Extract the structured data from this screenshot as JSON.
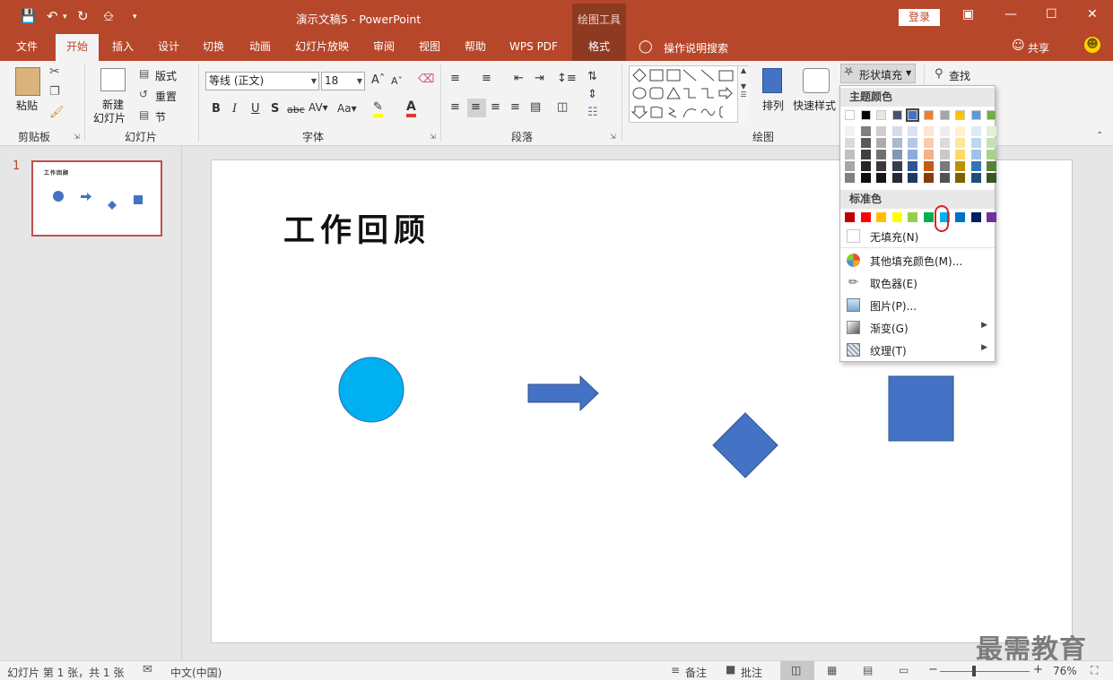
{
  "app": {
    "doc_title": "演示文稿5 - PowerPoint",
    "contextual_group": "绘图工具",
    "login": "登录"
  },
  "tabs": [
    "文件",
    "开始",
    "插入",
    "设计",
    "切换",
    "动画",
    "幻灯片放映",
    "审阅",
    "视图",
    "帮助",
    "WPS PDF",
    "格式"
  ],
  "tell_me": "操作说明搜索",
  "share": "共享",
  "ribbon": {
    "groups": {
      "clipboard": "剪贴板",
      "slides": "幻灯片",
      "font": "字体",
      "paragraph": "段落",
      "drawing": "绘图"
    },
    "paste": "粘贴",
    "new_slide_line1": "新建",
    "new_slide_line2": "幻灯片",
    "layout": "版式",
    "reset": "重置",
    "section": "节",
    "font_name": "等线 (正文)",
    "font_size": "18",
    "arrange": "排列",
    "quick_styles": "快速样式",
    "shape_fill": "形状填充",
    "find": "查找"
  },
  "fill_menu": {
    "theme_colors_title": "主题颜色",
    "standard_colors_title": "标准色",
    "theme_colors": [
      "#ffffff",
      "#000000",
      "#e7e6e6",
      "#44546a",
      "#4472c4",
      "#ed7d31",
      "#a5a5a5",
      "#ffc000",
      "#5b9bd5",
      "#70ad47"
    ],
    "theme_shades": [
      [
        "#f2f2f2",
        "#d9d9d9",
        "#bfbfbf",
        "#a6a6a6",
        "#808080"
      ],
      [
        "#7f7f7f",
        "#595959",
        "#404040",
        "#262626",
        "#0d0d0d"
      ],
      [
        "#d0cece",
        "#aeabab",
        "#757070",
        "#3a3838",
        "#171616"
      ],
      [
        "#d6dce5",
        "#adb9ca",
        "#8497b0",
        "#333f50",
        "#222a35"
      ],
      [
        "#dae3f3",
        "#b4c7e7",
        "#8faadc",
        "#2f5597",
        "#203864"
      ],
      [
        "#fbe5d6",
        "#f8cbad",
        "#f4b183",
        "#c55a11",
        "#843c0c"
      ],
      [
        "#ededed",
        "#dbdbdb",
        "#c9c9c9",
        "#7b7b7b",
        "#525252"
      ],
      [
        "#fff2cc",
        "#ffe699",
        "#ffd966",
        "#bf9000",
        "#7f6000"
      ],
      [
        "#deebf7",
        "#bdd7ee",
        "#9dc3e6",
        "#2e75b6",
        "#1f4e79"
      ],
      [
        "#e2f0d9",
        "#c5e0b4",
        "#a9d18e",
        "#548235",
        "#385723"
      ]
    ],
    "standard_colors": [
      "#c00000",
      "#ff0000",
      "#ffc000",
      "#ffff00",
      "#92d050",
      "#00b050",
      "#00b0f0",
      "#0070c0",
      "#002060",
      "#7030a0"
    ],
    "no_fill": "无填充(N)",
    "more_colors": "其他填充颜色(M)...",
    "eyedropper": "取色器(E)",
    "picture": "图片(P)...",
    "gradient": "渐变(G)",
    "texture": "纹理(T)"
  },
  "thumbnail": {
    "number": "1",
    "title": "工作回顾"
  },
  "slide": {
    "title": "工作回顾",
    "colors": {
      "circle": "#00b0f0",
      "shapes": "#4472c4"
    }
  },
  "status": {
    "slide_info": "幻灯片 第 1 张，共 1 张",
    "language": "中文(中国)",
    "notes": "备注",
    "comments": "批注",
    "zoom": "76%",
    "zoom_fraction": 0.76
  },
  "watermark": "最需教育"
}
